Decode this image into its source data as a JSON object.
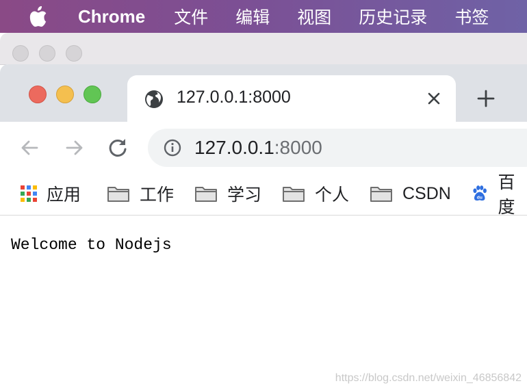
{
  "menubar": {
    "app_name": "Chrome",
    "items": [
      "文件",
      "编辑",
      "视图",
      "历史记录",
      "书签"
    ]
  },
  "tab": {
    "title": "127.0.0.1:8000",
    "icon": "globe-icon"
  },
  "omnibox": {
    "host": "127.0.0.1",
    "port": ":8000"
  },
  "bookmarks": [
    {
      "label": "应用",
      "icon": "apps-grid-icon"
    },
    {
      "label": "工作",
      "icon": "folder-icon"
    },
    {
      "label": "学习",
      "icon": "folder-icon"
    },
    {
      "label": "个人",
      "icon": "folder-icon"
    },
    {
      "label": "CSDN",
      "icon": "folder-icon"
    },
    {
      "label": "百度",
      "icon": "baidu-icon"
    }
  ],
  "page": {
    "text": "Welcome to Nodejs"
  },
  "watermark": "https://blog.csdn.net/weixin_46856842",
  "colors": {
    "traffic_red": "#ec6a5e",
    "traffic_yellow": "#f4bf4f",
    "traffic_green": "#61c554",
    "baidu_blue": "#2f6fe0"
  }
}
